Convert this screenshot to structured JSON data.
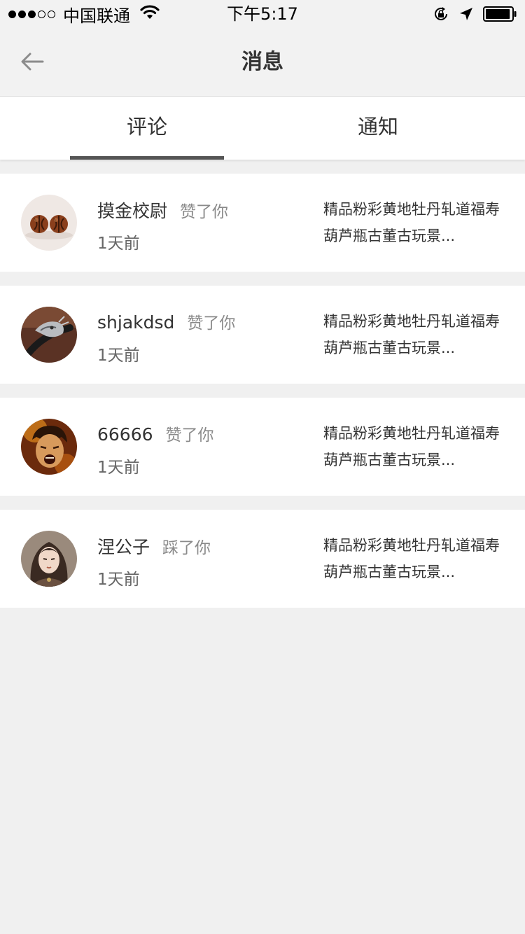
{
  "status_bar": {
    "carrier": "中国联通",
    "time": "下午5:17",
    "signal_bars": 3,
    "signal_total": 5,
    "battery_level": 0.95,
    "icons": [
      "wifi-icon",
      "rotation-lock-icon",
      "location-arrow-icon",
      "battery-icon"
    ]
  },
  "header": {
    "title": "消息",
    "back_icon": "back-arrow-icon"
  },
  "tabs": [
    {
      "label": "评论",
      "active": true
    },
    {
      "label": "通知",
      "active": false
    }
  ],
  "messages": [
    {
      "name": "摸金校尉",
      "action": "赞了你",
      "time": "1天前",
      "excerpt": "精品粉彩黄地牡丹轧道福寿葫芦瓶古董古玩景...",
      "avatar": "walnut-beads-avatar"
    },
    {
      "name": "shjakdsd",
      "action": "赞了你",
      "time": "1天前",
      "excerpt": "精品粉彩黄地牡丹轧道福寿葫芦瓶古董古玩景...",
      "avatar": "silver-dragon-avatar"
    },
    {
      "name": "66666",
      "action": "赞了你",
      "time": "1天前",
      "excerpt": "精品粉彩黄地牡丹轧道福寿葫芦瓶古董古玩景...",
      "avatar": "shouting-man-avatar"
    },
    {
      "name": "涅公子",
      "action": "踩了你",
      "time": "1天前",
      "excerpt": "精品粉彩黄地牡丹轧道福寿葫芦瓶古董古玩景...",
      "avatar": "anime-girl-avatar"
    }
  ],
  "colors": {
    "background": "#f0f0f0",
    "card": "#ffffff",
    "tab_indicator": "#555555",
    "muted_text": "#8a8a8a"
  }
}
